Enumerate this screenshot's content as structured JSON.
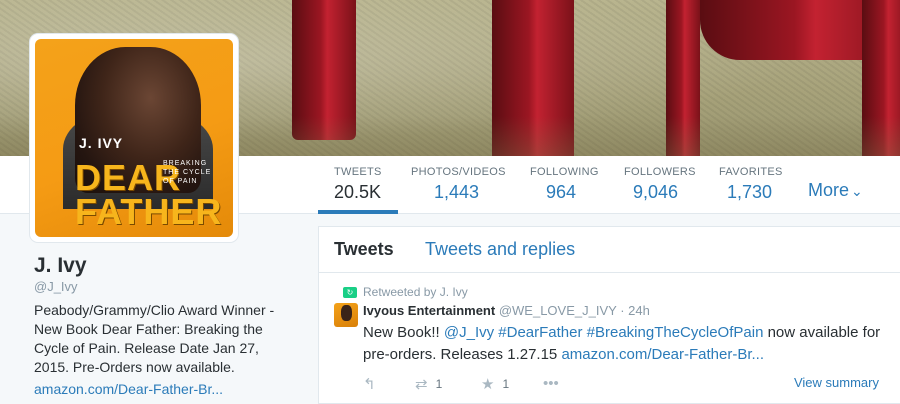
{
  "stats": [
    {
      "label": "TWEETS",
      "value": "20.5K"
    },
    {
      "label": "PHOTOS/VIDEOS",
      "value": "1,443"
    },
    {
      "label": "FOLLOWING",
      "value": "964"
    },
    {
      "label": "FOLLOWERS",
      "value": "9,046"
    },
    {
      "label": "FAVORITES",
      "value": "1,730"
    }
  ],
  "more_label": "More",
  "cover": {
    "author": "J. IVY",
    "title_line1": "DEAR",
    "title_line2": "FATHER",
    "subtitle": "BREAKING THE CYCLE OF PAIN"
  },
  "profile": {
    "name": "J. Ivy",
    "handle": "@J_Ivy",
    "bio": "Peabody/Grammy/Clio Award Winner - New Book Dear Father: Breaking the Cycle of Pain. Release Date Jan 27, 2015. Pre-Orders now available.",
    "link": "amazon.com/Dear-Father-Br..."
  },
  "timeline": {
    "tabs": [
      "Tweets",
      "Tweets and replies"
    ],
    "tweet": {
      "retweeted_by": "Retweeted by J. Ivy",
      "name": "Ivyous Entertainment",
      "handle": "@WE_LOVE_J_IVY",
      "separator": "·",
      "time": "24h",
      "text_1": "New Book!! ",
      "link_1": "@J_Ivy #DearFather #BreakingTheCycleOfPain",
      "text_2": " now available for pre-orders. Releases 1.27.15 ",
      "link_2": "amazon.com/Dear-Father-Br...",
      "retweets": "1",
      "favorites": "1",
      "view_summary": "View summary"
    }
  },
  "colors": {
    "link": "#2b7bb9",
    "muted": "#8899a6",
    "retweet_green": "#19cf86"
  },
  "icons": [
    "reply-icon",
    "retweet-icon",
    "favorite-icon",
    "more-dots-icon",
    "chevron-down-icon"
  ]
}
